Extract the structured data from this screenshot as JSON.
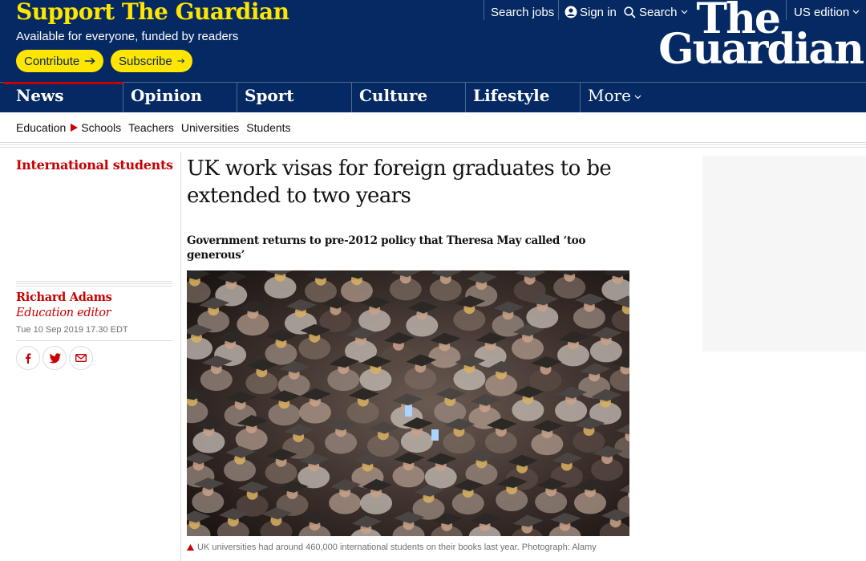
{
  "support": {
    "title": "Support The Guardian",
    "subtitle": "Available for everyone, funded by readers",
    "contribute_label": "Contribute",
    "subscribe_label": "Subscribe"
  },
  "top_links": {
    "search_jobs": "Search jobs",
    "sign_in": "Sign in",
    "search": "Search",
    "edition": "US edition"
  },
  "logo": {
    "line1": "The",
    "line2": "Guardian"
  },
  "pillars": [
    {
      "label": "News"
    },
    {
      "label": "Opinion"
    },
    {
      "label": "Sport"
    },
    {
      "label": "Culture"
    },
    {
      "label": "Lifestyle"
    },
    {
      "label": "More"
    }
  ],
  "subnav": {
    "current": "Education",
    "items": [
      "Schools",
      "Teachers",
      "Universities",
      "Students"
    ]
  },
  "article": {
    "kicker": "International students",
    "headline": "UK work visas for foreign graduates to be extended to two years",
    "standfirst": "Government returns to pre-2012 policy that Theresa May called ‘too generous’",
    "author": "Richard Adams",
    "author_role": "Education editor",
    "dateline": "Tue 10 Sep 2019 17.30 EDT",
    "caption": "UK universities had around 460,000 international students on their books last year. Photograph: Alamy"
  },
  "icons": {
    "contribute": "arrow-right-icon",
    "subscribe": "arrow-right-icon",
    "sign_in": "user-icon",
    "search": "search-icon",
    "subnav_marker": "triangle-right-icon",
    "caption_marker": "triangle-up-icon",
    "share": [
      "facebook-icon",
      "twitter-icon",
      "email-icon"
    ]
  },
  "colors": {
    "brand_navy": "#052962",
    "support_yellow": "#ffe500",
    "news_red": "#c70000",
    "rule_grey": "#dcdcdc",
    "meta_grey": "#707070"
  }
}
